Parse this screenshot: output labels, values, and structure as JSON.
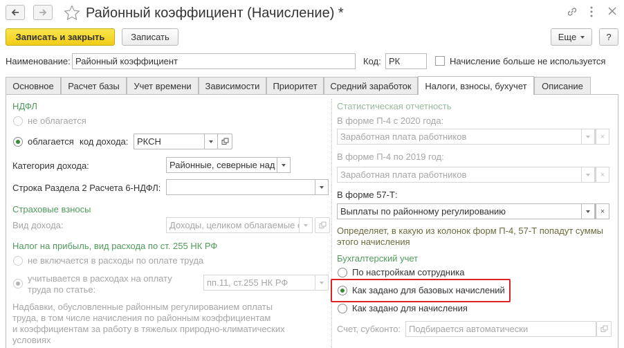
{
  "window": {
    "title": "Районный коэффициент (Начисление) *"
  },
  "toolbar": {
    "save_close_label": "Записать и закрыть",
    "save_label": "Записать",
    "more_label": "Еще",
    "help_label": "?"
  },
  "header": {
    "name_label": "Наименование:",
    "name_value": "Районный коэффициент",
    "code_label": "Код:",
    "code_value": "РК",
    "unused_label": "Начисление больше не используется"
  },
  "tabs": [
    {
      "label": "Основное"
    },
    {
      "label": "Расчет базы"
    },
    {
      "label": "Учет времени"
    },
    {
      "label": "Зависимости"
    },
    {
      "label": "Приоритет"
    },
    {
      "label": "Средний заработок"
    },
    {
      "label": "Налоги, взносы, бухучет"
    },
    {
      "label": "Описание"
    }
  ],
  "left": {
    "ndfl_heading": "НДФЛ",
    "ndfl_not_taxed": "не облагается",
    "ndfl_taxed": "облагается",
    "income_code_label": "код дохода:",
    "income_code_value": "РКСН",
    "income_category_label": "Категория дохода:",
    "income_category_value": "Районные, северные над",
    "row6_label": "Строка Раздела 2 Расчета 6-НДФЛ:",
    "row6_value": "",
    "insurance_heading": "Страховые взносы",
    "income_type_label": "Вид дохода:",
    "income_type_value": "Доходы, целиком облагаемые с",
    "profit_tax_heading": "Налог на прибыль, вид расхода по ст. 255 НК РФ",
    "not_included": "не включается в расходы по оплате труда",
    "included_line1": "учитывается в расходах на оплату",
    "included_line2": "труда по статье:",
    "article_value": "пп.11, ст.255 НК РФ",
    "description": [
      "Надбавки, обусловленные районным регулированием оплаты",
      "труда, в том числе начисления по районным коэффициентам",
      "и коэффициентам за работу в тяжелых природно-климатических",
      "условиях"
    ]
  },
  "right": {
    "stat_heading": "Статистическая отчетность",
    "p4_2020_label": "В форме П-4 с 2020 года:",
    "p4_2020_value": "Заработная плата работников",
    "p4_2019_label": "В форме П-4 по 2019 год:",
    "p4_2019_value": "Заработная плата работников",
    "f57_label": "В форме 57-Т:",
    "f57_value": "Выплаты по районному регулированию",
    "stat_note_line1": "Определяет, в какую из колонок форм П-4, 57-Т попадут суммы",
    "stat_note_line2": "этого начисления",
    "accounting_heading": "Бухгалтерский учет",
    "opt_employee": "По настройкам сотрудника",
    "opt_base": "Как задано для базовых начислений",
    "opt_accrual": "Как задано для начисления",
    "account_label": "Счет, субконто:",
    "account_placeholder": "Подбирается автоматически"
  },
  "colors": {
    "primary_button": "#f5d521",
    "section_heading": "#4f9a5a",
    "highlight_box": "#dd2222",
    "note_text": "#6b6b3b"
  }
}
